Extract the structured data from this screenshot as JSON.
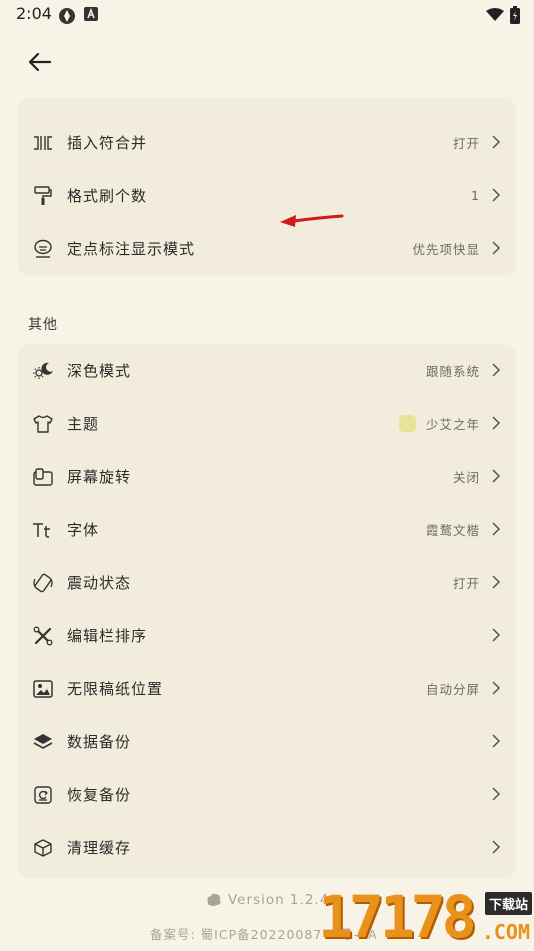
{
  "status_bar": {
    "time": "2:04"
  },
  "card1": {
    "rows": [
      {
        "label": "插入符合并",
        "value": "打开",
        "icon": "merge-cursor-icon"
      },
      {
        "label": "格式刷个数",
        "value": "1",
        "icon": "paint-roller-icon"
      },
      {
        "label": "定点标注显示模式",
        "value": "优先项快显",
        "icon": "annotation-icon"
      }
    ]
  },
  "section_other": {
    "title": "其他"
  },
  "card2": {
    "rows": [
      {
        "label": "深色模式",
        "value": "跟随系统",
        "icon": "day-night-icon"
      },
      {
        "label": "主题",
        "value": "少艾之年",
        "icon": "shirt-icon",
        "swatch_color": "#e6e49a"
      },
      {
        "label": "屏幕旋转",
        "value": "关闭",
        "icon": "screen-rotate-icon"
      },
      {
        "label": "字体",
        "value": "霞鹜文楷",
        "icon": "font-icon"
      },
      {
        "label": "震动状态",
        "value": "打开",
        "icon": "vibration-icon"
      },
      {
        "label": "编辑栏排序",
        "value": "",
        "icon": "tools-icon"
      },
      {
        "label": "无限稿纸位置",
        "value": "自动分屏",
        "icon": "image-frame-icon"
      },
      {
        "label": "数据备份",
        "value": "",
        "icon": "layers-icon"
      },
      {
        "label": "恢复备份",
        "value": "",
        "icon": "restore-icon"
      },
      {
        "label": "清理缓存",
        "value": "",
        "icon": "box-icon"
      }
    ]
  },
  "footer": {
    "version": "Version 1.2.4",
    "icp": "备案号: 蜀ICP备2022008770号-2A"
  },
  "watermark": {
    "digits": "17178",
    "badge": "下载站",
    "domain": ".COM"
  },
  "colors": {
    "background": "#f7f3e6",
    "card": "#f1ecdc",
    "text": "#2b2b2b",
    "value_text": "#6f6b62",
    "arrow": "#d21a1a",
    "watermark": "#e8921c"
  }
}
